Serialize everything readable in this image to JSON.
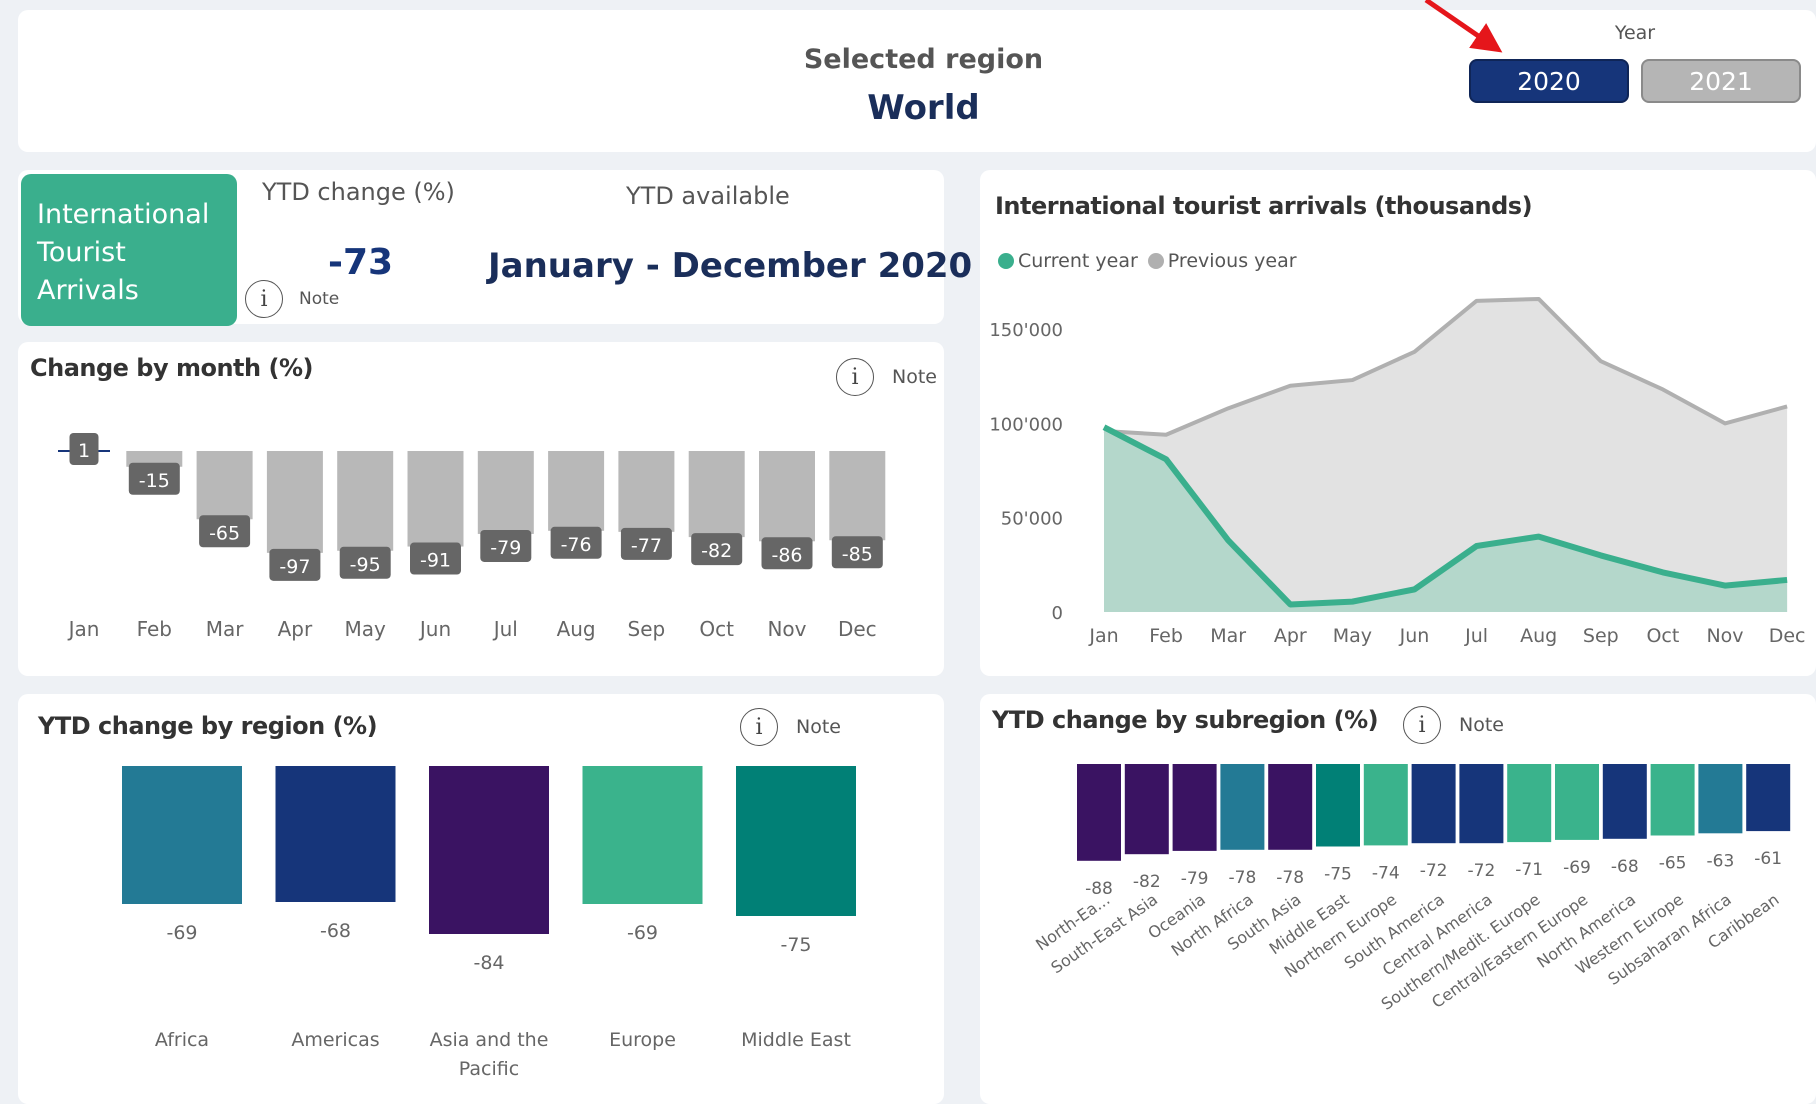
{
  "header": {
    "selected_region_label": "Selected region",
    "region_name": "World",
    "year_label": "Year",
    "years": [
      {
        "label": "2020",
        "selected": true
      },
      {
        "label": "2021",
        "selected": false
      }
    ]
  },
  "kpi": {
    "tile_lines": [
      "International",
      "Tourist",
      "Arrivals"
    ],
    "ytd_change_label": "YTD change (%)",
    "ytd_change_value": "-73",
    "note_label": "Note",
    "ytd_available_label": "YTD available",
    "ytd_available_value": "January - December 2020"
  },
  "colors": {
    "accent_green": "#3aaf8d",
    "navy": "#16357a",
    "bar_gray": "#b8b8b8",
    "label_dark": "#666666",
    "arrow_red": "#e5161b"
  },
  "chart_data": [
    {
      "id": "change_by_month",
      "type": "bar",
      "title": "Change by month (%)",
      "note": "Note",
      "categories": [
        "Jan",
        "Feb",
        "Mar",
        "Apr",
        "May",
        "Jun",
        "Jul",
        "Aug",
        "Sep",
        "Oct",
        "Nov",
        "Dec"
      ],
      "values": [
        1,
        -15,
        -65,
        -97,
        -95,
        -91,
        -79,
        -76,
        -77,
        -82,
        -86,
        -85
      ],
      "labels": [
        "1",
        "-15",
        "-65",
        "-97",
        "-95",
        "-91",
        "-79",
        "-76",
        "-77",
        "-82",
        "-86",
        "-85"
      ]
    },
    {
      "id": "arrivals",
      "type": "area",
      "title": "International tourist arrivals (thousands)",
      "legend_position": "top-left",
      "categories": [
        "Jan",
        "Feb",
        "Mar",
        "Apr",
        "May",
        "Jun",
        "Jul",
        "Aug",
        "Sep",
        "Oct",
        "Nov",
        "Dec"
      ],
      "yticks": [
        "150'000",
        "100'000",
        "50'000",
        "0"
      ],
      "ylim": [
        0,
        175000
      ],
      "series": [
        {
          "name": "Previous year",
          "color": "#b0b0b0",
          "fill": "#e2e2e2",
          "values": [
            96000,
            94000,
            108000,
            120000,
            123000,
            138000,
            165000,
            166000,
            133000,
            118000,
            100000,
            109000
          ]
        },
        {
          "name": "Current year",
          "color": "#3aaf8d",
          "fill": "#b4d7cb",
          "values": [
            98000,
            81000,
            38000,
            4000,
            5500,
            12000,
            35000,
            40000,
            30000,
            21000,
            14000,
            17000
          ]
        }
      ]
    },
    {
      "id": "ytd_by_region",
      "type": "bar",
      "title": "YTD change by region (%)",
      "note": "Note",
      "categories": [
        "Africa",
        "Americas",
        "Asia and the Pacific",
        "Europe",
        "Middle East"
      ],
      "category_lines": [
        [
          "Africa"
        ],
        [
          "Americas"
        ],
        [
          "Asia and the",
          "Pacific"
        ],
        [
          "Europe"
        ],
        [
          "Middle East"
        ]
      ],
      "values": [
        -69,
        -68,
        -84,
        -69,
        -75
      ],
      "colors": [
        "#237a95",
        "#16357a",
        "#3a1362",
        "#3ab38c",
        "#018076"
      ]
    },
    {
      "id": "ytd_by_subregion",
      "type": "bar",
      "title": "YTD change by subregion (%)",
      "note": "Note",
      "categories": [
        "North-Ea...",
        "South-East Asia",
        "Oceania",
        "North Africa",
        "South Asia",
        "Middle East",
        "Northern Europe",
        "South America",
        "Central America",
        "Southern/Medit. Europe",
        "Central/Eastern Europe",
        "North America",
        "Western Europe",
        "Subsaharan Africa",
        "Caribbean"
      ],
      "values": [
        -88,
        -82,
        -79,
        -78,
        -78,
        -75,
        -74,
        -72,
        -72,
        -71,
        -69,
        -68,
        -65,
        -63,
        -61
      ],
      "colors": [
        "#3a1362",
        "#3a1362",
        "#3a1362",
        "#237a95",
        "#3a1362",
        "#018076",
        "#3ab38c",
        "#16357a",
        "#16357a",
        "#3ab38c",
        "#3ab38c",
        "#16357a",
        "#3ab38c",
        "#237a95",
        "#16357a"
      ]
    }
  ]
}
